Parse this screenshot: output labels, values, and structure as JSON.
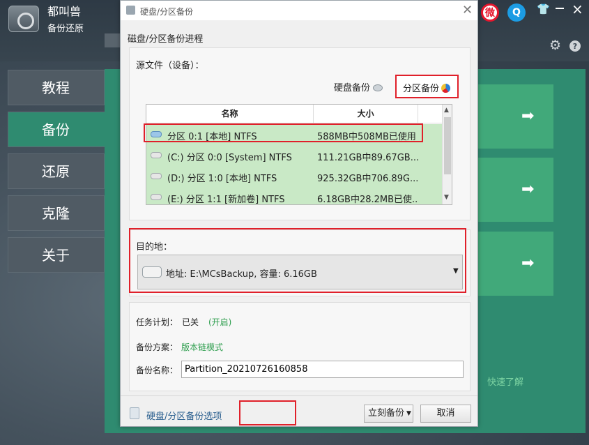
{
  "app": {
    "brand": "都叫兽",
    "subtitle": "备份还原",
    "icons": [
      "weibo-icon",
      "qq-icon",
      "shirt-icon",
      "minimize-icon",
      "close-icon",
      "gear-icon",
      "help-icon"
    ],
    "nav": [
      {
        "label": "教程",
        "active": false
      },
      {
        "label": "备份",
        "active": true
      },
      {
        "label": "还原",
        "active": false
      },
      {
        "label": "克隆",
        "active": false
      },
      {
        "label": "关于",
        "active": false
      }
    ],
    "quick_link": "快速了解",
    "colors": {
      "accent_green": "#2f8b70",
      "highlight_red": "#e0202a",
      "link_green": "#2e9e4e"
    }
  },
  "dialog": {
    "title": "硬盘/分区备份",
    "heading": "磁盘/分区备份进程",
    "source_label": "源文件（设备）：",
    "tabs": {
      "disk": "硬盘备份",
      "partition": "分区备份"
    },
    "table": {
      "columns": [
        "名称",
        "大小"
      ],
      "rows": [
        {
          "name": "分区 0:1 [本地] NTFS",
          "size": "588MB中508MB已使用",
          "selected": true
        },
        {
          "name": "(C:) 分区 0:0 [System] NTFS",
          "size": "111.21GB中89.67GB...",
          "selected": false
        },
        {
          "name": "(D:) 分区 1:0 [本地] NTFS",
          "size": "925.32GB中706.89G...",
          "selected": false
        },
        {
          "name": "(E:) 分区 1:1 [新加卷] NTFS",
          "size": "6.18GB中28.2MB已使...",
          "selected": false
        }
      ]
    },
    "destination": {
      "label": "目的地：",
      "value": "地址: E:\\MCsBackup, 容量: 6.16GB"
    },
    "task": {
      "schedule_label": "任务计划：",
      "schedule_value": "已关",
      "schedule_link": "(开启)",
      "scheme_label": "备份方案：",
      "scheme_link": "版本链模式",
      "name_label": "备份名称：",
      "name_value": "Partition_20210726160858"
    },
    "footer": {
      "options_link": "硬盘/分区备份选项",
      "backup_button": "立刻备份",
      "cancel_button": "取消"
    }
  }
}
